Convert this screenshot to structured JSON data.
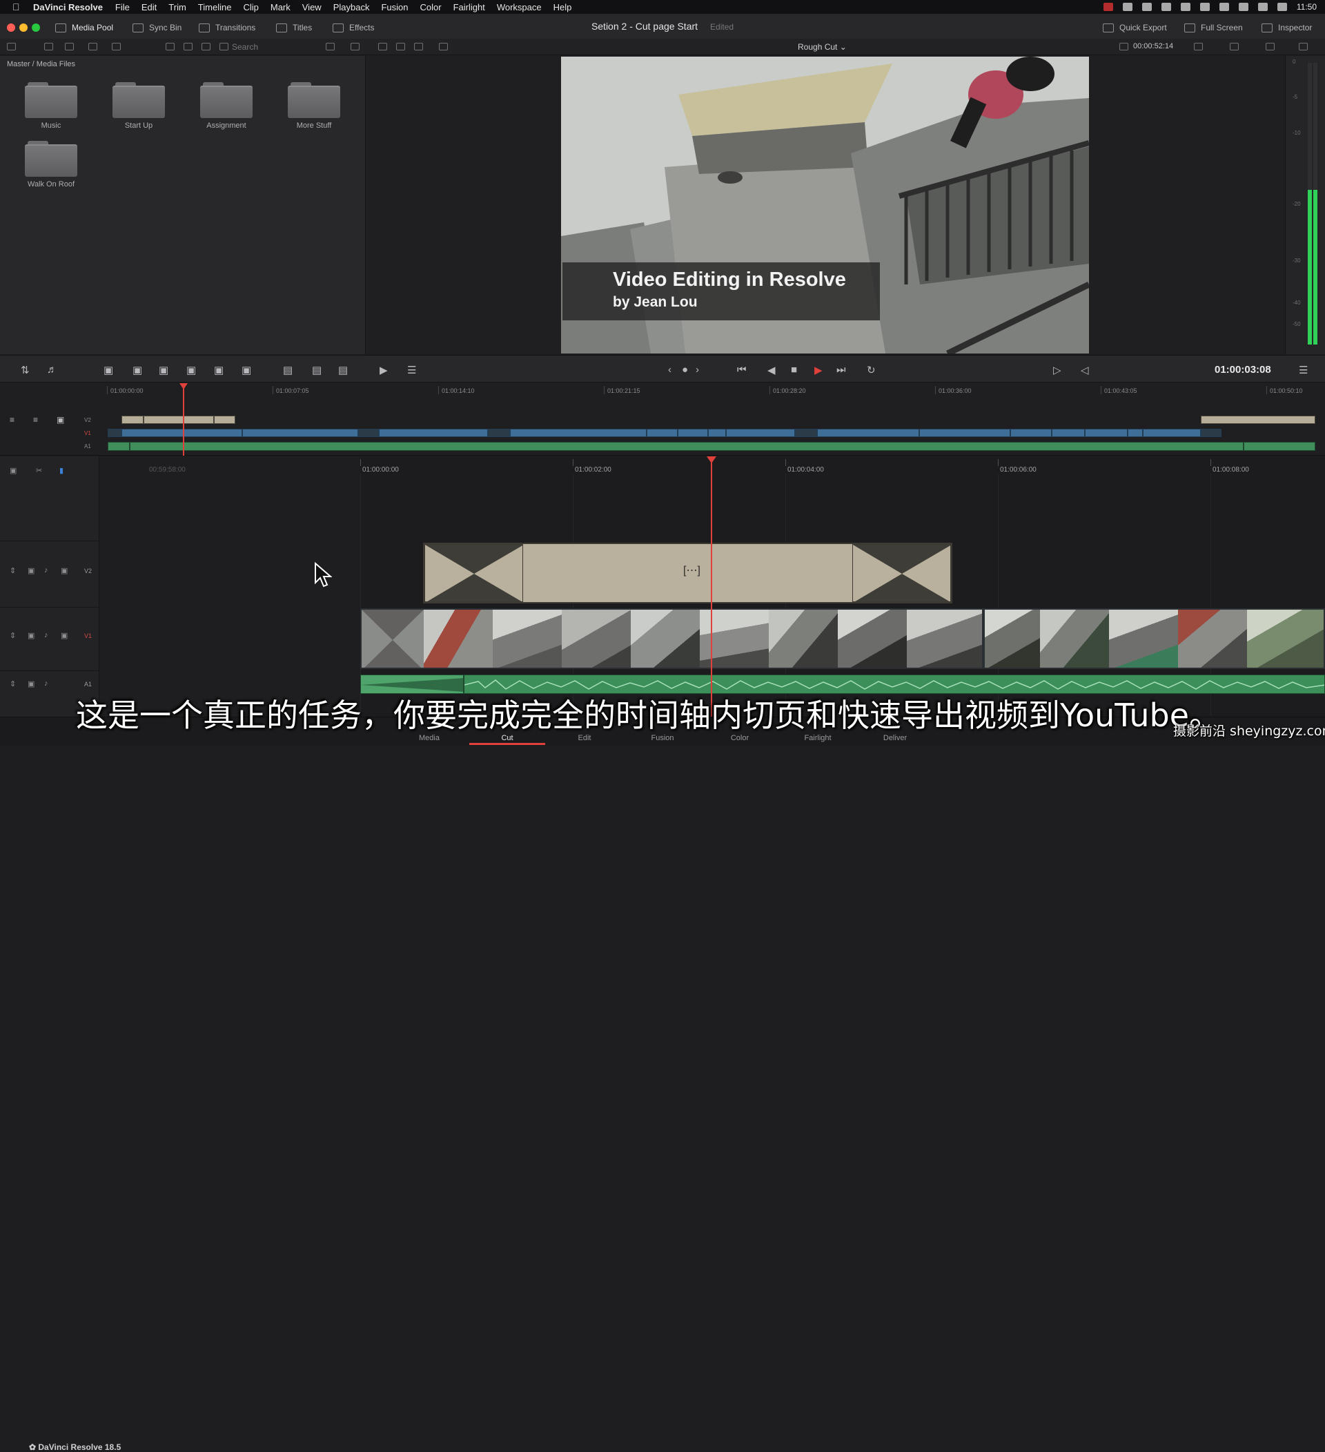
{
  "menubar": {
    "app_name": "DaVinci Resolve",
    "items": [
      "File",
      "Edit",
      "Trim",
      "Timeline",
      "Clip",
      "Mark",
      "View",
      "Playback",
      "Fusion",
      "Color",
      "Fairlight",
      "Workspace",
      "Help"
    ],
    "clock": "11:50"
  },
  "toolbar": {
    "media_pool": "Media Pool",
    "sync_bin": "Sync Bin",
    "transitions": "Transitions",
    "titles": "Titles",
    "effects": "Effects",
    "project_title": "Setion 2 - Cut page Start",
    "edited": "Edited",
    "quick_export": "Quick Export",
    "full_screen": "Full Screen",
    "inspector": "Inspector"
  },
  "toolbar2": {
    "search_placeholder": "Search",
    "timeline_name": "Rough Cut",
    "timecode": "00:00:52:14"
  },
  "media_pool": {
    "breadcrumb": "Master / Media Files",
    "folders": [
      "Music",
      "Start Up",
      "Assignment",
      "More Stuff",
      "Walk On Roof"
    ]
  },
  "viewer": {
    "title_line1": "Video Editing in Resolve",
    "title_line2": "by Jean Lou"
  },
  "audio_meter": {
    "labels": [
      "0",
      "-5",
      "-10",
      "-20",
      "-30",
      "-40",
      "-50"
    ],
    "level": 0.55
  },
  "transport": {
    "timecode": "01:00:03:08"
  },
  "overview": {
    "ruler": [
      "01:00:00:00",
      "01:00:07:05",
      "01:00:14:10",
      "01:00:21:15",
      "01:00:28:20",
      "01:00:36:00",
      "01:00:43:05",
      "01:00:50:10"
    ],
    "tracks": [
      "V2",
      "V1",
      "A1"
    ]
  },
  "timeline": {
    "pre_label": "00:59:58:00",
    "ruler": [
      "01:00:00:00",
      "01:00:02:00",
      "01:00:04:00",
      "01:00:06:00",
      "01:00:08:00"
    ],
    "tracks": [
      "V2",
      "V1",
      "A1"
    ]
  },
  "pages": {
    "logo": "DaVinci Resolve 18.5",
    "tabs": [
      "Media",
      "Cut",
      "Edit",
      "Fusion",
      "Color",
      "Fairlight",
      "Deliver"
    ]
  },
  "overlay": {
    "subtitle": "这是一个真正的任务，你要完成完全的时间轴内切页和快速导出视频到YouTube。",
    "watermark": "摄影前沿 sheyingzyz.com"
  },
  "colors": {
    "accent": "#e0413a",
    "video_clip": "#3f6f98",
    "audio_clip": "#3f8e5c",
    "title_clip": "#b9b19d"
  }
}
